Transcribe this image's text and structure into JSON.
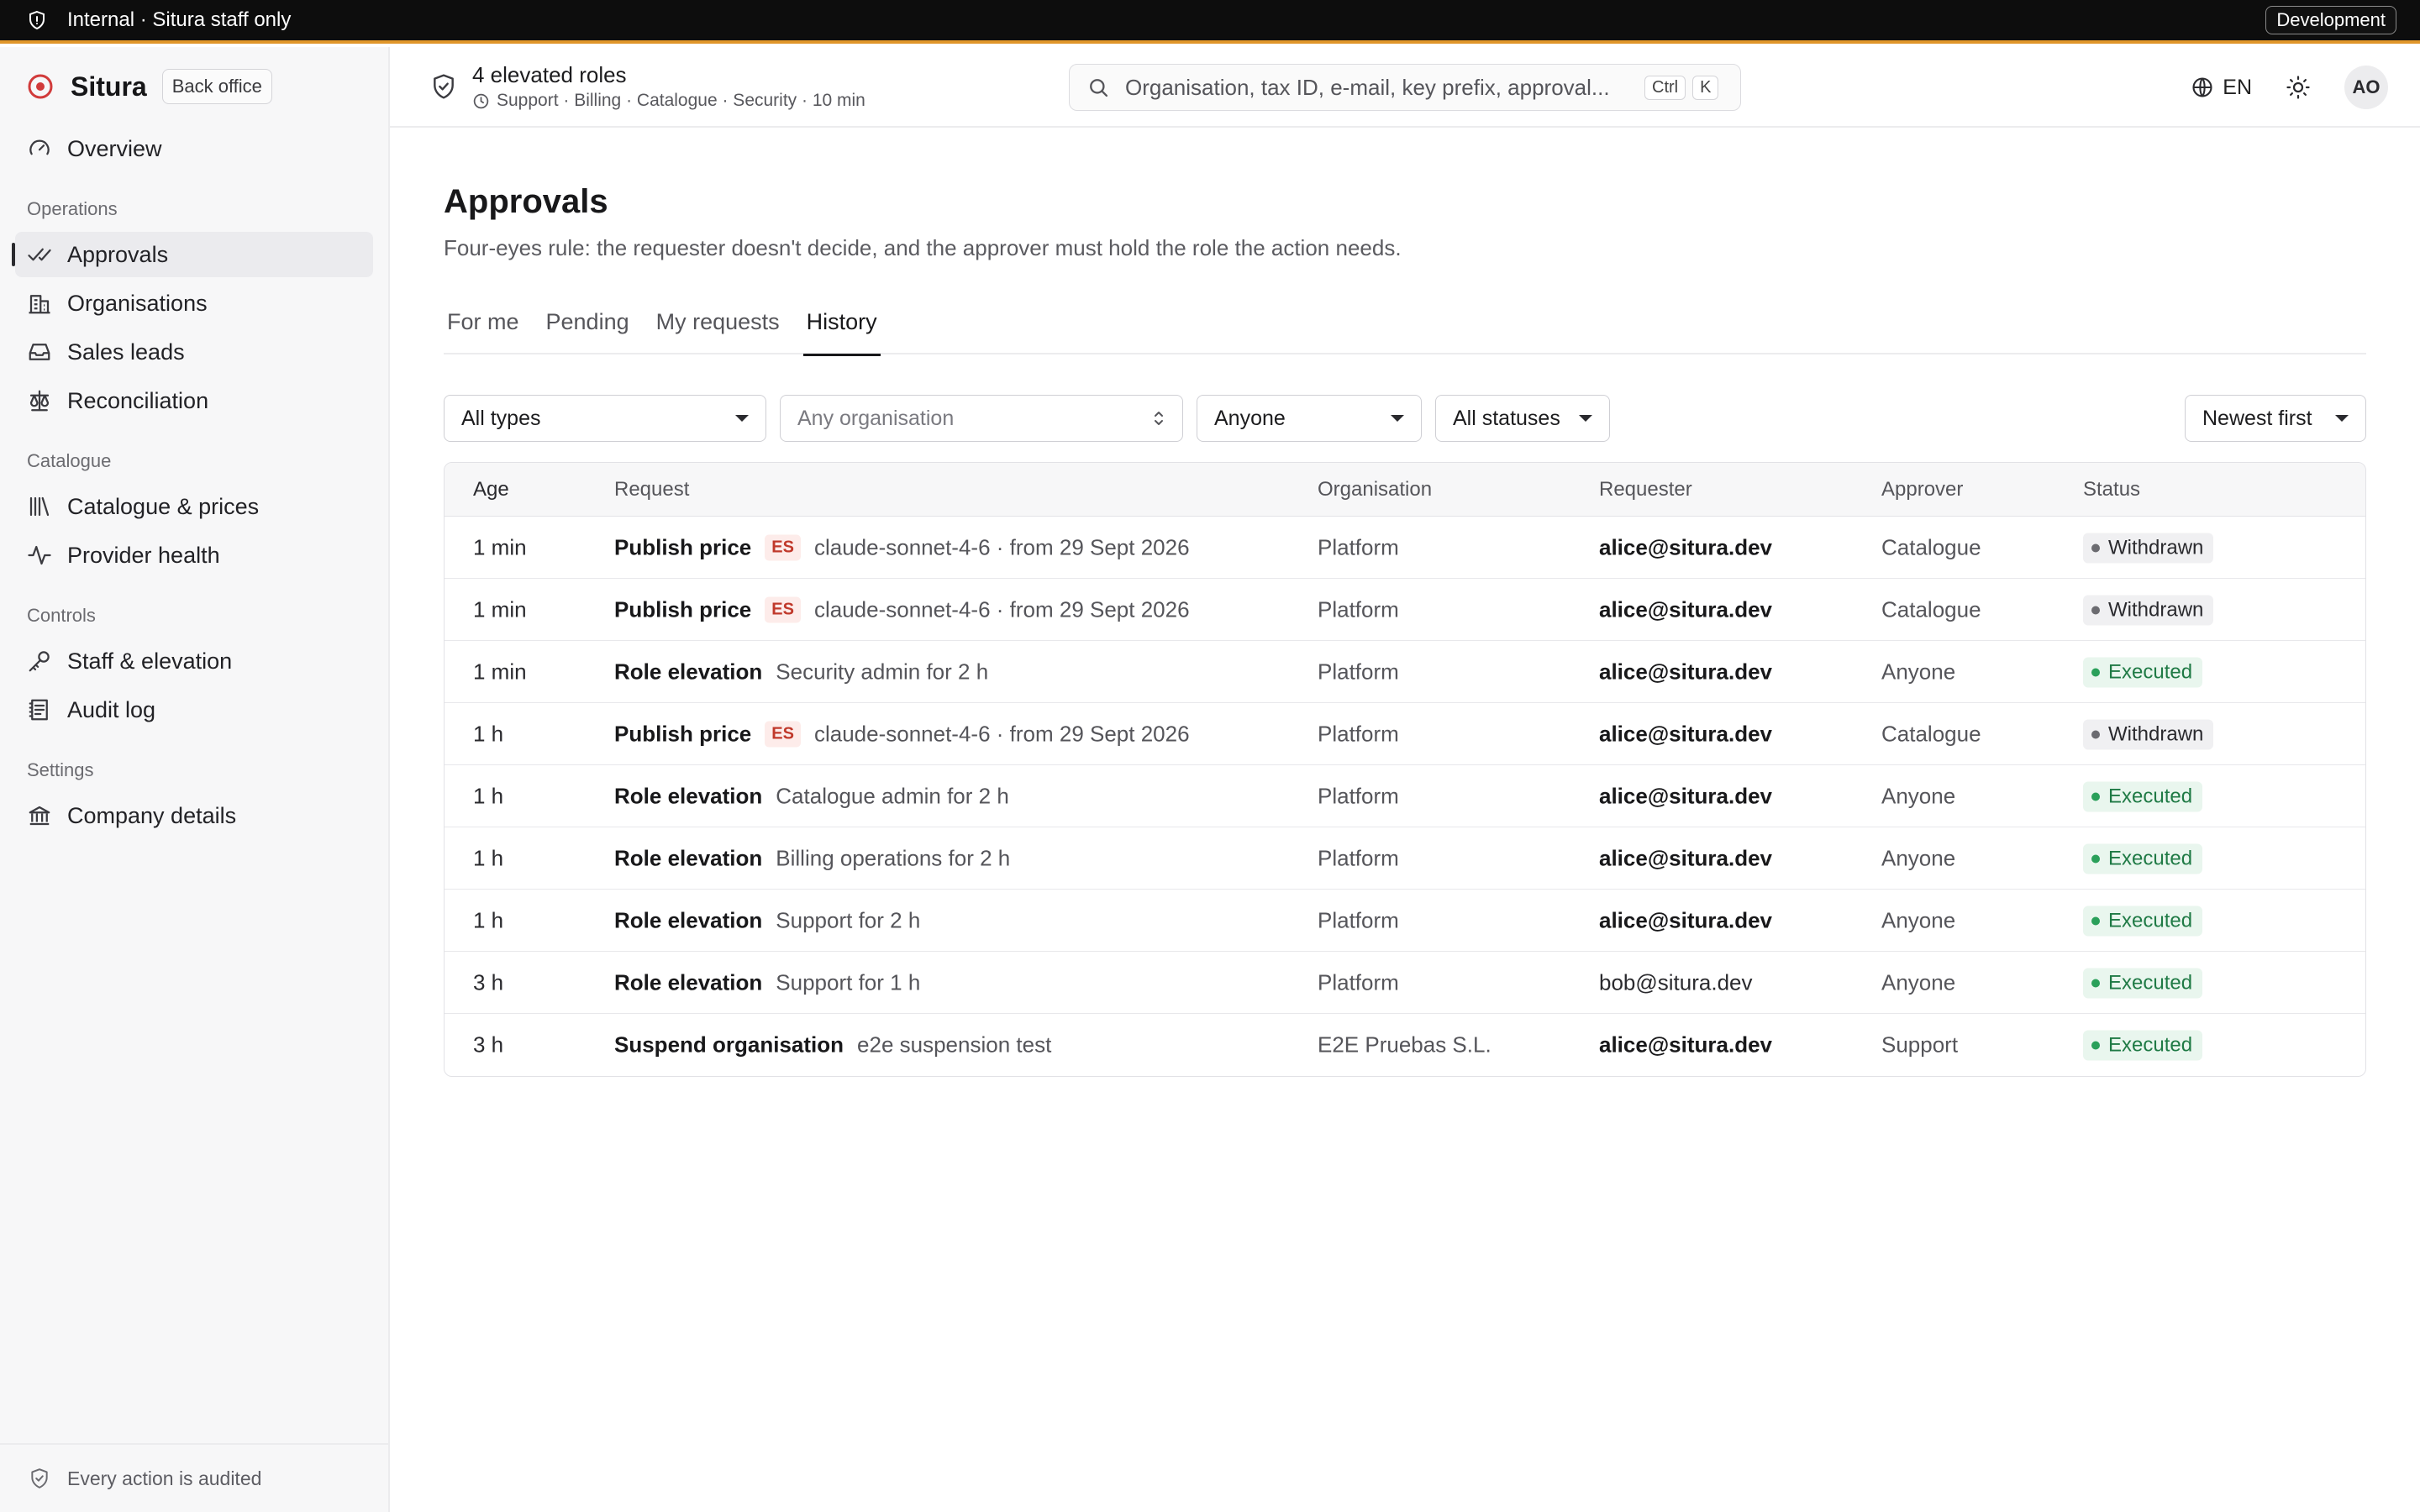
{
  "banner": {
    "text": "Internal · Situra staff only",
    "environment": "Development",
    "accent_color": "#e0962a"
  },
  "brand": {
    "name": "Situra",
    "pill": "Back office",
    "logo_color": "#d13b3b"
  },
  "sidebar": {
    "overview": {
      "label": "Overview",
      "icon": "gauge-icon"
    },
    "sections": [
      {
        "title": "Operations",
        "items": [
          {
            "label": "Approvals",
            "icon": "check-double-icon",
            "active": true
          },
          {
            "label": "Organisations",
            "icon": "building-icon"
          },
          {
            "label": "Sales leads",
            "icon": "inbox-icon"
          },
          {
            "label": "Reconciliation",
            "icon": "scale-icon"
          }
        ]
      },
      {
        "title": "Catalogue",
        "items": [
          {
            "label": "Catalogue & prices",
            "icon": "library-icon"
          },
          {
            "label": "Provider health",
            "icon": "activity-icon"
          }
        ]
      },
      {
        "title": "Controls",
        "items": [
          {
            "label": "Staff & elevation",
            "icon": "key-icon"
          },
          {
            "label": "Audit log",
            "icon": "log-icon"
          }
        ]
      },
      {
        "title": "Settings",
        "items": [
          {
            "label": "Company details",
            "icon": "bank-icon"
          }
        ]
      }
    ],
    "footer": "Every action is audited"
  },
  "header": {
    "roles_title": "4 elevated roles",
    "roles_sub": "Support · Billing · Catalogue · Security · 10 min",
    "search_placeholder": "Organisation, tax ID, e-mail, key prefix, approval...",
    "kbd_ctrl": "Ctrl",
    "kbd_k": "K",
    "language": "EN",
    "avatar": "AO"
  },
  "page": {
    "title": "Approvals",
    "subtitle": "Four-eyes rule: the requester doesn't decide, and the approver must hold the role the action needs.",
    "tabs": [
      {
        "label": "For me"
      },
      {
        "label": "Pending"
      },
      {
        "label": "My requests"
      },
      {
        "label": "History",
        "active": true
      }
    ],
    "filters": {
      "type": "All types",
      "organisation_placeholder": "Any organisation",
      "requester": "Anyone",
      "status": "All statuses",
      "sort": "Newest first"
    }
  },
  "table": {
    "columns": [
      "Age",
      "Request",
      "Organisation",
      "Requester",
      "Approver",
      "Status"
    ],
    "rows": [
      {
        "age": "1 min",
        "type": "Publish price",
        "tag": "ES",
        "detail": "claude-sonnet-4-6 · from 29 Sept 2026",
        "org": "Platform",
        "requester": "alice@situra.dev",
        "requester_bold": true,
        "approver": "Catalogue",
        "status": "Withdrawn"
      },
      {
        "age": "1 min",
        "type": "Publish price",
        "tag": "ES",
        "detail": "claude-sonnet-4-6 · from 29 Sept 2026",
        "org": "Platform",
        "requester": "alice@situra.dev",
        "requester_bold": true,
        "approver": "Catalogue",
        "status": "Withdrawn"
      },
      {
        "age": "1 min",
        "type": "Role elevation",
        "tag": "",
        "detail": "Security admin for 2 h",
        "org": "Platform",
        "requester": "alice@situra.dev",
        "requester_bold": true,
        "approver": "Anyone",
        "status": "Executed"
      },
      {
        "age": "1 h",
        "type": "Publish price",
        "tag": "ES",
        "detail": "claude-sonnet-4-6 · from 29 Sept 2026",
        "org": "Platform",
        "requester": "alice@situra.dev",
        "requester_bold": true,
        "approver": "Catalogue",
        "status": "Withdrawn"
      },
      {
        "age": "1 h",
        "type": "Role elevation",
        "tag": "",
        "detail": "Catalogue admin for 2 h",
        "org": "Platform",
        "requester": "alice@situra.dev",
        "requester_bold": true,
        "approver": "Anyone",
        "status": "Executed"
      },
      {
        "age": "1 h",
        "type": "Role elevation",
        "tag": "",
        "detail": "Billing operations for 2 h",
        "org": "Platform",
        "requester": "alice@situra.dev",
        "requester_bold": true,
        "approver": "Anyone",
        "status": "Executed"
      },
      {
        "age": "1 h",
        "type": "Role elevation",
        "tag": "",
        "detail": "Support for 2 h",
        "org": "Platform",
        "requester": "alice@situra.dev",
        "requester_bold": true,
        "approver": "Anyone",
        "status": "Executed"
      },
      {
        "age": "3 h",
        "type": "Role elevation",
        "tag": "",
        "detail": "Support for 1 h",
        "org": "Platform",
        "requester": "bob@situra.dev",
        "requester_bold": false,
        "approver": "Anyone",
        "status": "Executed"
      },
      {
        "age": "3 h",
        "type": "Suspend organisation",
        "tag": "",
        "detail": "e2e suspension test",
        "org": "E2E Pruebas S.L.",
        "requester": "alice@situra.dev",
        "requester_bold": true,
        "approver": "Support",
        "status": "Executed"
      }
    ]
  }
}
